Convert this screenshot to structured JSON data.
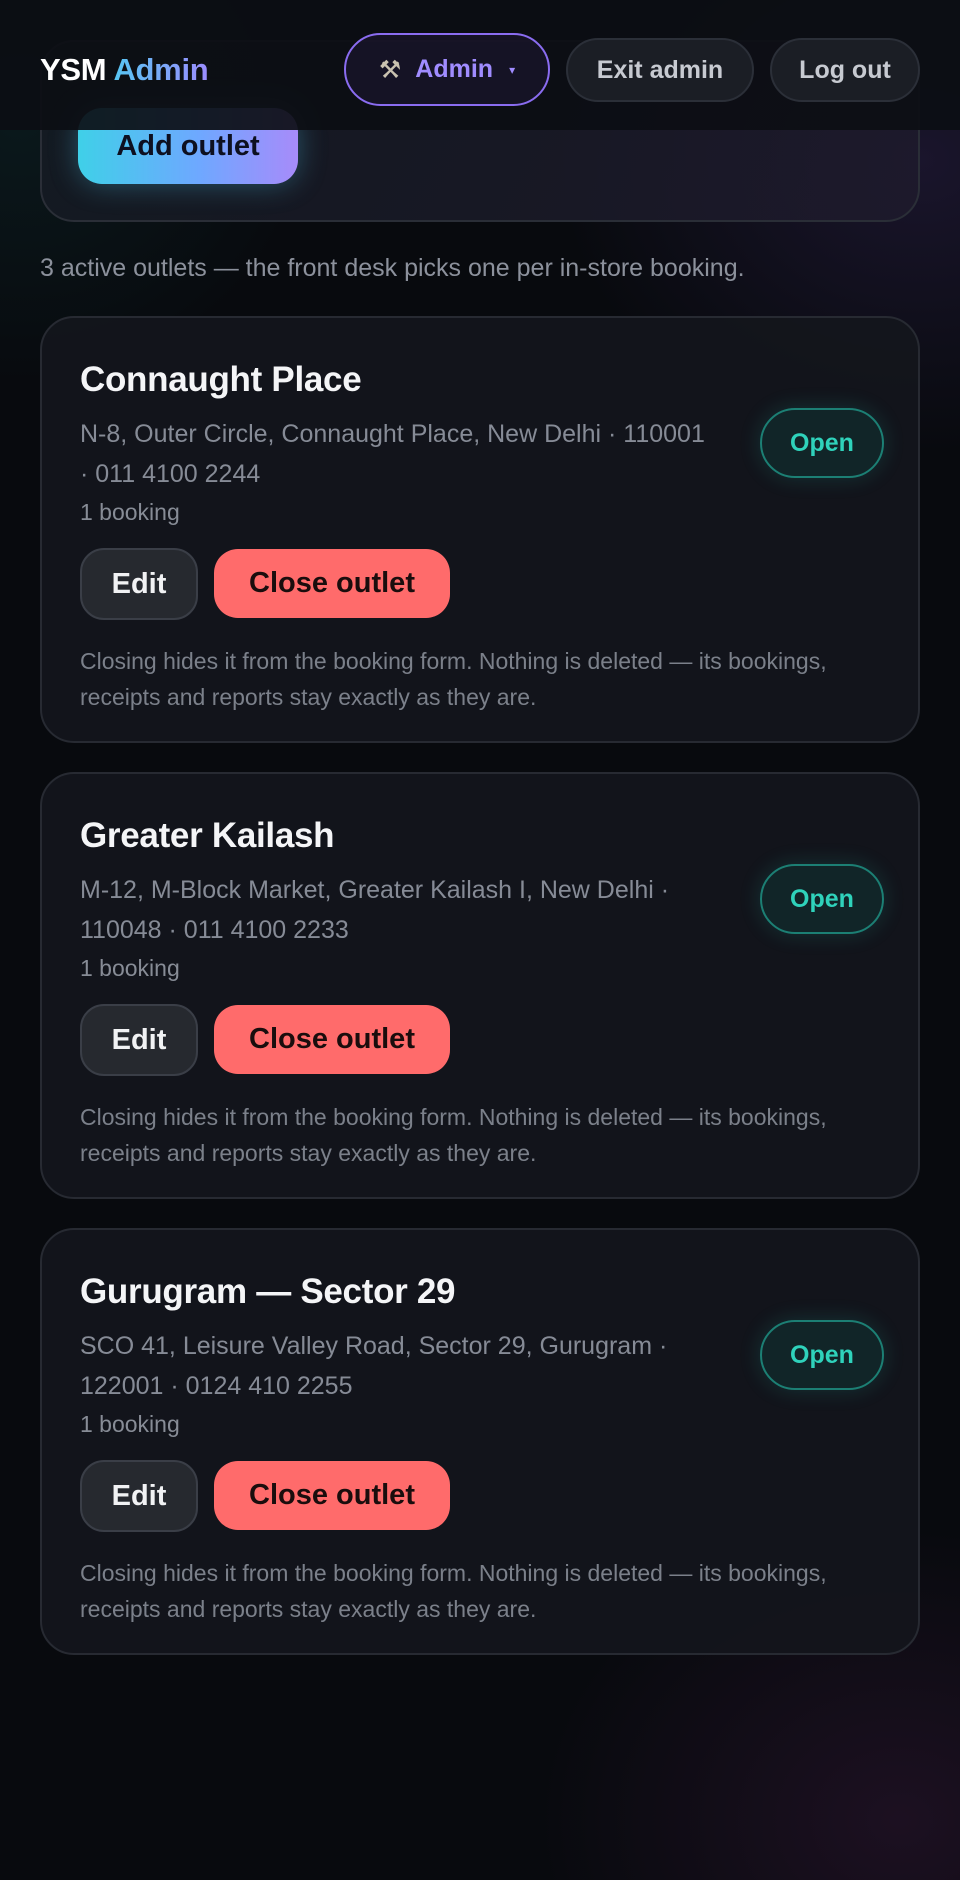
{
  "header": {
    "brand_primary": "YSM",
    "brand_accent": "Admin",
    "admin_menu": {
      "icon": "hammer-wrench-icon",
      "label": "Admin",
      "caret": "▾"
    },
    "exit_admin_label": "Exit admin",
    "logout_label": "Log out"
  },
  "toolbar": {
    "add_outlet_label": "Add outlet"
  },
  "summary": "3 active outlets — the front desk picks one per in-store booking.",
  "outlets": [
    {
      "name": "Connaught Place",
      "address": "N-8, Outer Circle, Connaught Place, New Delhi · 110001 · 011 4100 2244",
      "bookings": "1 booking",
      "status": "Open",
      "edit_label": "Edit",
      "close_label": "Close outlet",
      "note": "Closing hides it from the booking form. Nothing is deleted — its bookings, receipts and reports stay exactly as they are."
    },
    {
      "name": "Greater Kailash",
      "address": "M-12, M-Block Market, Greater Kailash I, New Delhi · 110048 · 011 4100 2233",
      "bookings": "1 booking",
      "status": "Open",
      "edit_label": "Edit",
      "close_label": "Close outlet",
      "note": "Closing hides it from the booking form. Nothing is deleted — its bookings, receipts and reports stay exactly as they are."
    },
    {
      "name": "Gurugram — Sector 29",
      "address": "SCO 41, Leisure Valley Road, Sector 29, Gurugram · 122001 · 0124 410 2255",
      "bookings": "1 booking",
      "status": "Open",
      "edit_label": "Edit",
      "close_label": "Close outlet",
      "note": "Closing hides it from the booking form. Nothing is deleted — its bookings, receipts and reports stay exactly as they are."
    }
  ],
  "colors": {
    "accent_violet": "#8a6cf0",
    "accent_cyan": "#4fc3f7",
    "status_open": "#2fd2bb",
    "danger": "#ff6b6b",
    "background": "#080a0e"
  }
}
